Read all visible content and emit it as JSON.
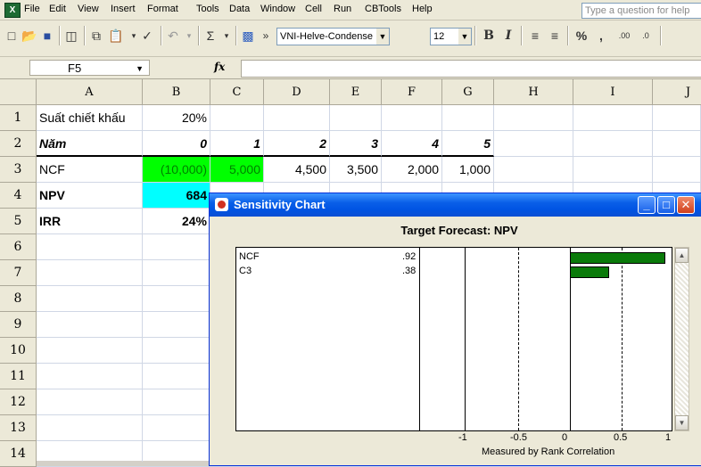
{
  "menubar": {
    "items": [
      "File",
      "Edit",
      "View",
      "Insert",
      "Format",
      "Tools",
      "Data",
      "Window",
      "Cell",
      "Run",
      "CBTools",
      "Help"
    ],
    "ask_placeholder": "Type a question for help"
  },
  "toolbar": {
    "font_name": "VNI-Helve-Condense",
    "font_size": "12",
    "bold": "B",
    "italic": "I",
    "percent": "%",
    "comma": ",",
    "sum": "Σ",
    "more": "»",
    "inc_decimal": ".00",
    "dec_decimal": ".0"
  },
  "formula_bar": {
    "name_box": "F5",
    "fx": "fx",
    "content": ""
  },
  "grid": {
    "columns": [
      "A",
      "B",
      "C",
      "D",
      "E",
      "F",
      "G",
      "H",
      "I",
      "J"
    ],
    "rows": [
      "1",
      "2",
      "3",
      "4",
      "5",
      "6",
      "7",
      "8",
      "9",
      "10",
      "11",
      "12",
      "13",
      "14"
    ],
    "cells": {
      "A1": "Suất chiết khấu",
      "B1": "20%",
      "A2": "Năm",
      "B2": "0",
      "C2": "1",
      "D2": "2",
      "E2": "3",
      "F2": "4",
      "G2": "5",
      "A3": "NCF",
      "B3": "(10,000)",
      "C3": "5,000",
      "D3": "4,500",
      "E3": "3,500",
      "F3": "2,000",
      "G3": "1,000",
      "A4": "NPV",
      "B4": "684",
      "A5": "IRR",
      "B5": "24%"
    },
    "colors": {
      "green_fill": "#00ff00",
      "cyan_fill": "#00ffff",
      "green_text": "#008000"
    }
  },
  "dialog": {
    "title": "Sensitivity Chart",
    "target": "Target Forecast:  NPV",
    "bars": [
      {
        "label": "NCF",
        "value": ".92",
        "correlation": 0.92
      },
      {
        "label": "C3",
        "value": ".38",
        "correlation": 0.38
      }
    ],
    "axis_ticks": [
      "-1",
      "-0.5",
      "0",
      "0.5",
      "1"
    ],
    "axis_caption": "Measured by Rank Correlation",
    "bar_color": "#0a7a0a"
  }
}
